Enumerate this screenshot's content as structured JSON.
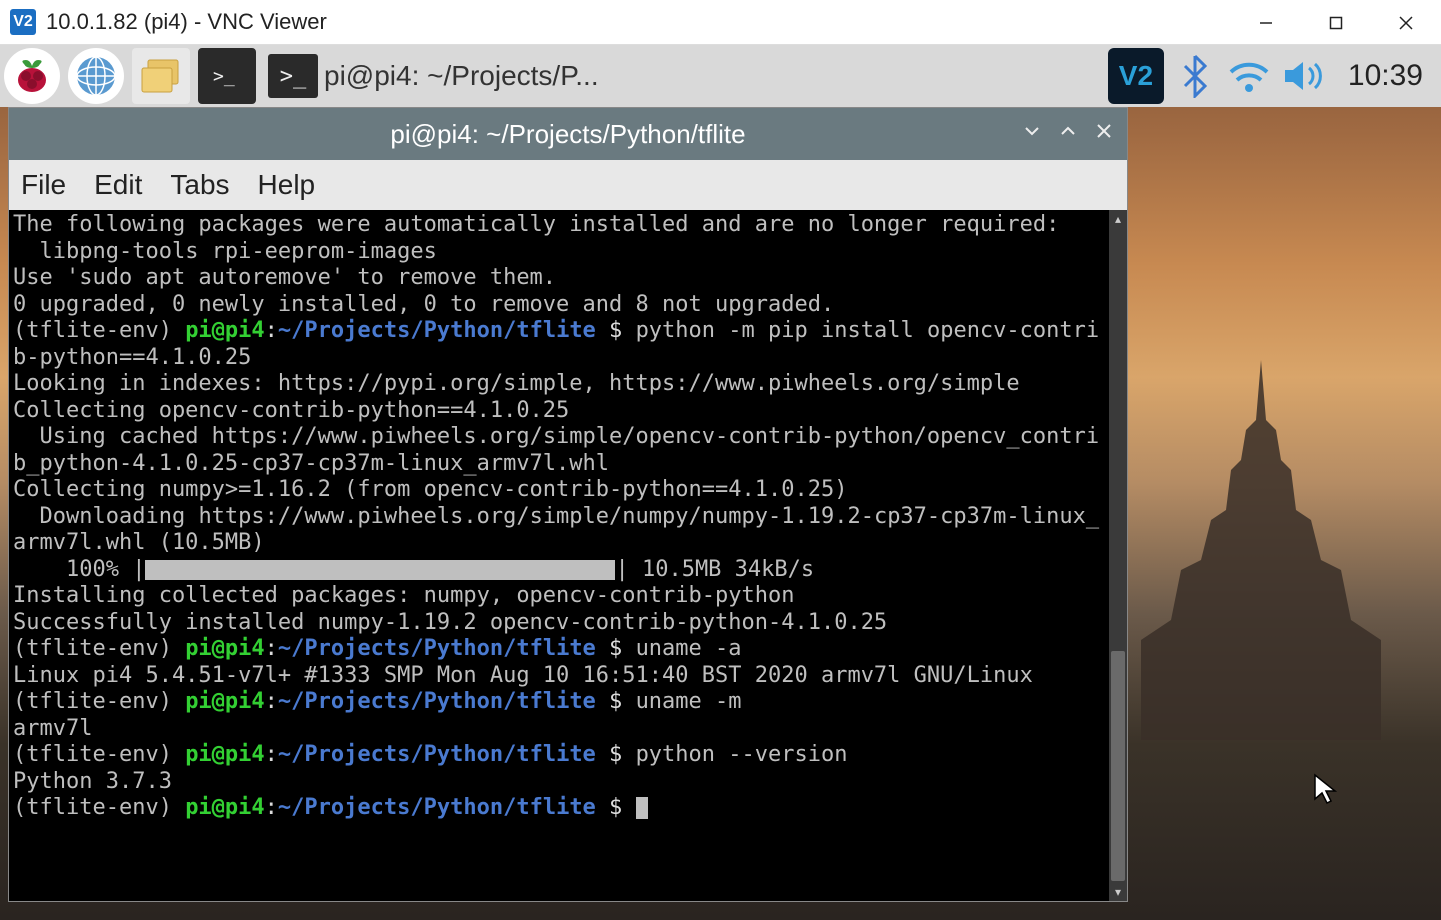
{
  "window": {
    "title": "10.0.1.82 (pi4) - VNC Viewer",
    "vnc_logo": "V2"
  },
  "taskbar": {
    "app_title": "pi@pi4: ~/Projects/P...",
    "clock": "10:39",
    "vnc_tray": "V2"
  },
  "terminal": {
    "title": "pi@pi4: ~/Projects/Python/tflite",
    "menus": {
      "file": "File",
      "edit": "Edit",
      "tabs": "Tabs",
      "help": "Help"
    },
    "prompt": {
      "env": "(tflite-env) ",
      "userhost": "pi@pi4",
      "sep": ":",
      "cwd": "~/Projects/Python/tflite",
      "dollar": " $ "
    },
    "lines": {
      "l1": "The following packages were automatically installed and are no longer required:",
      "l2": "  libpng-tools rpi-eeprom-images",
      "l3": "Use 'sudo apt autoremove' to remove them.",
      "l4": "0 upgraded, 0 newly installed, 0 to remove and 8 not upgraded.",
      "cmd1": "python -m pip install opencv-contrib-python==4.1.0.25",
      "l6": "Looking in indexes: https://pypi.org/simple, https://www.piwheels.org/simple",
      "l7": "Collecting opencv-contrib-python==4.1.0.25",
      "l8": "  Using cached https://www.piwheels.org/simple/opencv-contrib-python/opencv_contrib_python-4.1.0.25-cp37-cp37m-linux_armv7l.whl",
      "l9": "Collecting numpy>=1.16.2 (from opencv-contrib-python==4.1.0.25)",
      "l10": "  Downloading https://www.piwheels.org/simple/numpy/numpy-1.19.2-cp37-cp37m-linux_armv7l.whl (10.5MB)",
      "prog_pct": "    100% |",
      "prog_tail": "| 10.5MB 34kB/s",
      "l12": "Installing collected packages: numpy, opencv-contrib-python",
      "l13": "Successfully installed numpy-1.19.2 opencv-contrib-python-4.1.0.25",
      "cmd2": "uname -a",
      "l15": "Linux pi4 5.4.51-v7l+ #1333 SMP Mon Aug 10 16:51:40 BST 2020 armv7l GNU/Linux",
      "cmd3": "uname -m",
      "l17": "armv7l",
      "cmd4": "python --version",
      "l19": "Python 3.7.3"
    }
  }
}
